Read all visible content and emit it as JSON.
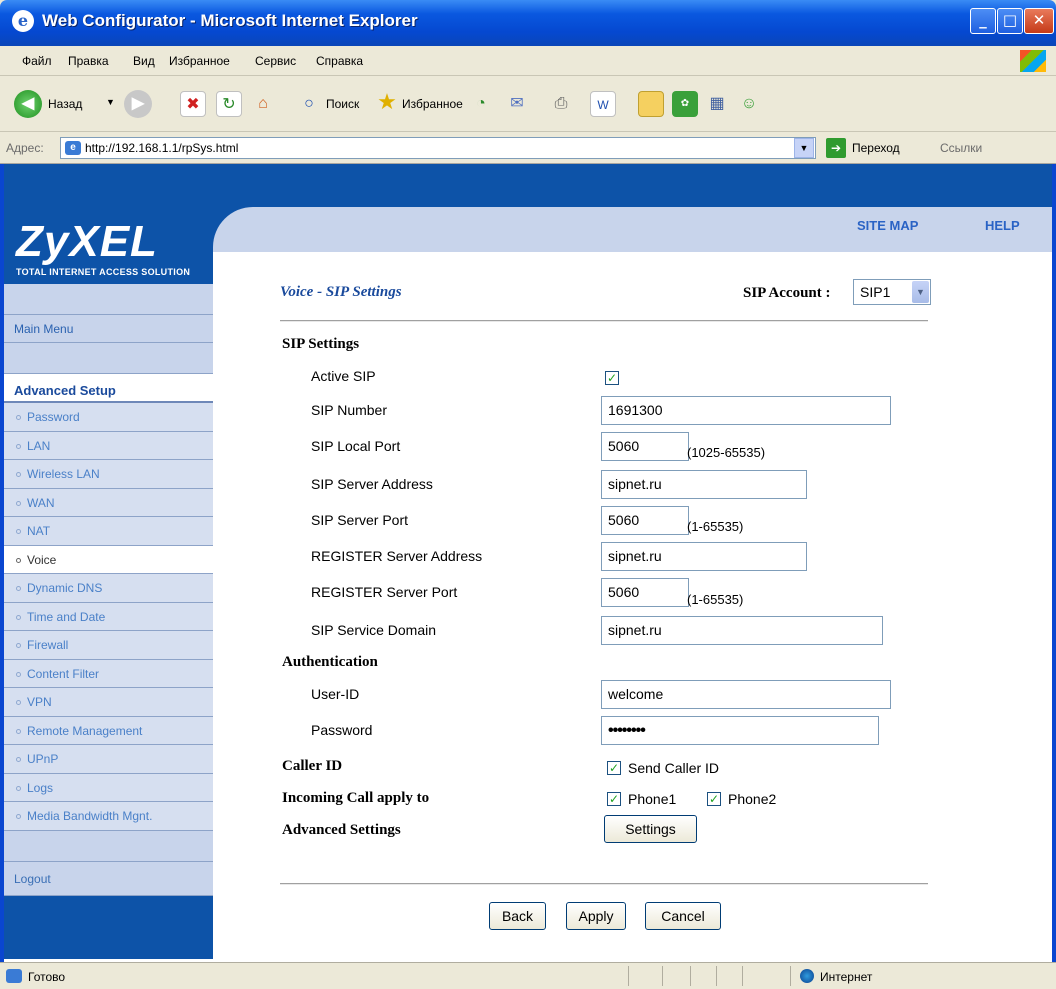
{
  "window": {
    "title": "Web Configurator - Microsoft Internet Explorer",
    "minimize": "_",
    "maximize": "□",
    "close": "✕"
  },
  "menu": {
    "items": [
      "Файл",
      "Правка",
      "Вид",
      "Избранное",
      "Сервис",
      "Справка"
    ]
  },
  "toolbar": {
    "back": "Назад",
    "search": "Поиск",
    "favorites": "Избранное"
  },
  "address": {
    "label": "Адрес:",
    "url": "http://192.168.1.1/rpSys.html",
    "go": "Переход",
    "links": "Ссылки"
  },
  "brand": {
    "logo": "ZyXEL",
    "tagline": "TOTAL INTERNET ACCESS SOLUTION"
  },
  "toplinks": {
    "sitemap": "SITE MAP",
    "help": "HELP"
  },
  "nav": {
    "main_menu": "Main Menu",
    "advanced": "Advanced Setup",
    "items": [
      "Password",
      "LAN",
      "Wireless LAN",
      "WAN",
      "NAT",
      "Voice",
      "Dynamic DNS",
      "Time and Date",
      "Firewall",
      "Content Filter",
      "VPN",
      "Remote Management",
      "UPnP",
      "Logs",
      "Media Bandwidth Mgnt."
    ],
    "active": "Voice",
    "logout": "Logout"
  },
  "page": {
    "title": "Voice - SIP Settings",
    "account_label": "SIP Account :",
    "account_value": "SIP1",
    "sip_settings": "SIP Settings",
    "active_sip": "Active SIP",
    "sip_number_label": "SIP Number",
    "sip_number": "1691300",
    "local_port_label": "SIP Local Port",
    "local_port": "5060",
    "local_port_range": "(1025-65535)",
    "server_address_label": "SIP Server Address",
    "server_address": "sipnet.ru",
    "server_port_label": "SIP Server Port",
    "server_port": "5060",
    "server_port_range": "(1-65535)",
    "register_address_label": "REGISTER Server Address",
    "register_address": "sipnet.ru",
    "register_port_label": "REGISTER Server Port",
    "register_port": "5060",
    "register_port_range": "(1-65535)",
    "service_domain_label": "SIP Service Domain",
    "service_domain": "sipnet.ru",
    "authentication": "Authentication",
    "user_id_label": "User-ID",
    "user_id": "welcome",
    "password_label": "Password",
    "password_mask": "••••••••",
    "caller_id": "Caller ID",
    "send_caller_id": "Send Caller ID",
    "incoming_call": "Incoming Call apply to",
    "phone1": "Phone1",
    "phone2": "Phone2",
    "advanced_settings": "Advanced Settings",
    "settings_button": "Settings",
    "back": "Back",
    "apply": "Apply",
    "cancel": "Cancel"
  },
  "status": {
    "text": "Готово",
    "zone": "Интернет"
  }
}
